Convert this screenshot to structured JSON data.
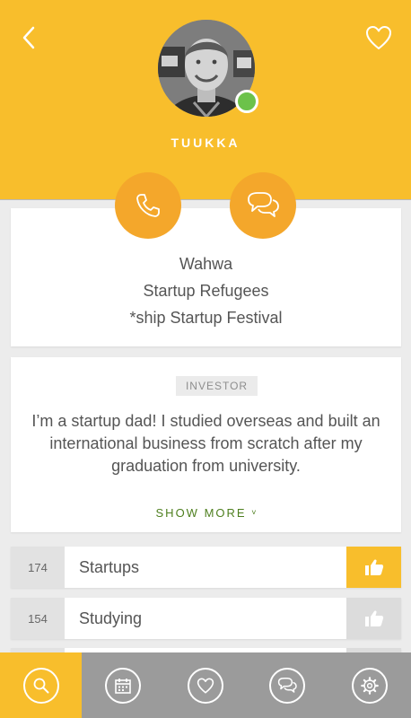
{
  "profile": {
    "name": "TUUKKA",
    "online": true,
    "avatar_icon": "person-photo"
  },
  "colors": {
    "accent": "#f8be2c",
    "accent_dark": "#f4a72b",
    "online": "#6cc24a",
    "link": "#4e7f1f",
    "tabbar": "#9b9b9b"
  },
  "header": {
    "back_icon": "chevron-left-icon",
    "favorite_icon": "heart-icon"
  },
  "actions": {
    "call_icon": "phone-icon",
    "chat_icon": "chat-bubbles-icon"
  },
  "companies": [
    "Wahwa",
    "Startup Refugees",
    "*ship Startup Festival"
  ],
  "bio": {
    "role": "INVESTOR",
    "text": "I’m a startup dad! I studied overseas and built an international business from scratch after my graduation from university.",
    "show_more": "SHOW MORE"
  },
  "interests": [
    {
      "count": "174",
      "label": "Startups",
      "liked": true
    },
    {
      "count": "154",
      "label": "Studying",
      "liked": false
    },
    {
      "count": "",
      "label": "",
      "liked": false
    }
  ],
  "tabbar": {
    "items": [
      {
        "icon": "search-icon",
        "active": true
      },
      {
        "icon": "calendar-icon",
        "active": false
      },
      {
        "icon": "heart-icon",
        "active": false
      },
      {
        "icon": "chat-icon",
        "active": false
      },
      {
        "icon": "gear-icon",
        "active": false
      }
    ]
  }
}
